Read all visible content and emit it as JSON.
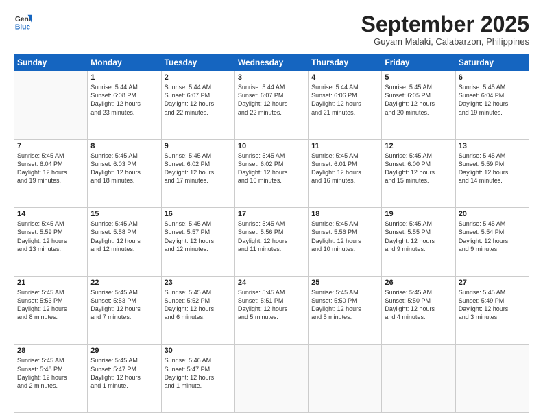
{
  "header": {
    "logo_line1": "General",
    "logo_line2": "Blue",
    "month": "September 2025",
    "location": "Guyam Malaki, Calabarzon, Philippines"
  },
  "weekdays": [
    "Sunday",
    "Monday",
    "Tuesday",
    "Wednesday",
    "Thursday",
    "Friday",
    "Saturday"
  ],
  "weeks": [
    [
      {
        "day": "",
        "text": ""
      },
      {
        "day": "1",
        "text": "Sunrise: 5:44 AM\nSunset: 6:08 PM\nDaylight: 12 hours\nand 23 minutes."
      },
      {
        "day": "2",
        "text": "Sunrise: 5:44 AM\nSunset: 6:07 PM\nDaylight: 12 hours\nand 22 minutes."
      },
      {
        "day": "3",
        "text": "Sunrise: 5:44 AM\nSunset: 6:07 PM\nDaylight: 12 hours\nand 22 minutes."
      },
      {
        "day": "4",
        "text": "Sunrise: 5:44 AM\nSunset: 6:06 PM\nDaylight: 12 hours\nand 21 minutes."
      },
      {
        "day": "5",
        "text": "Sunrise: 5:45 AM\nSunset: 6:05 PM\nDaylight: 12 hours\nand 20 minutes."
      },
      {
        "day": "6",
        "text": "Sunrise: 5:45 AM\nSunset: 6:04 PM\nDaylight: 12 hours\nand 19 minutes."
      }
    ],
    [
      {
        "day": "7",
        "text": "Sunrise: 5:45 AM\nSunset: 6:04 PM\nDaylight: 12 hours\nand 19 minutes."
      },
      {
        "day": "8",
        "text": "Sunrise: 5:45 AM\nSunset: 6:03 PM\nDaylight: 12 hours\nand 18 minutes."
      },
      {
        "day": "9",
        "text": "Sunrise: 5:45 AM\nSunset: 6:02 PM\nDaylight: 12 hours\nand 17 minutes."
      },
      {
        "day": "10",
        "text": "Sunrise: 5:45 AM\nSunset: 6:02 PM\nDaylight: 12 hours\nand 16 minutes."
      },
      {
        "day": "11",
        "text": "Sunrise: 5:45 AM\nSunset: 6:01 PM\nDaylight: 12 hours\nand 16 minutes."
      },
      {
        "day": "12",
        "text": "Sunrise: 5:45 AM\nSunset: 6:00 PM\nDaylight: 12 hours\nand 15 minutes."
      },
      {
        "day": "13",
        "text": "Sunrise: 5:45 AM\nSunset: 5:59 PM\nDaylight: 12 hours\nand 14 minutes."
      }
    ],
    [
      {
        "day": "14",
        "text": "Sunrise: 5:45 AM\nSunset: 5:59 PM\nDaylight: 12 hours\nand 13 minutes."
      },
      {
        "day": "15",
        "text": "Sunrise: 5:45 AM\nSunset: 5:58 PM\nDaylight: 12 hours\nand 12 minutes."
      },
      {
        "day": "16",
        "text": "Sunrise: 5:45 AM\nSunset: 5:57 PM\nDaylight: 12 hours\nand 12 minutes."
      },
      {
        "day": "17",
        "text": "Sunrise: 5:45 AM\nSunset: 5:56 PM\nDaylight: 12 hours\nand 11 minutes."
      },
      {
        "day": "18",
        "text": "Sunrise: 5:45 AM\nSunset: 5:56 PM\nDaylight: 12 hours\nand 10 minutes."
      },
      {
        "day": "19",
        "text": "Sunrise: 5:45 AM\nSunset: 5:55 PM\nDaylight: 12 hours\nand 9 minutes."
      },
      {
        "day": "20",
        "text": "Sunrise: 5:45 AM\nSunset: 5:54 PM\nDaylight: 12 hours\nand 9 minutes."
      }
    ],
    [
      {
        "day": "21",
        "text": "Sunrise: 5:45 AM\nSunset: 5:53 PM\nDaylight: 12 hours\nand 8 minutes."
      },
      {
        "day": "22",
        "text": "Sunrise: 5:45 AM\nSunset: 5:53 PM\nDaylight: 12 hours\nand 7 minutes."
      },
      {
        "day": "23",
        "text": "Sunrise: 5:45 AM\nSunset: 5:52 PM\nDaylight: 12 hours\nand 6 minutes."
      },
      {
        "day": "24",
        "text": "Sunrise: 5:45 AM\nSunset: 5:51 PM\nDaylight: 12 hours\nand 5 minutes."
      },
      {
        "day": "25",
        "text": "Sunrise: 5:45 AM\nSunset: 5:50 PM\nDaylight: 12 hours\nand 5 minutes."
      },
      {
        "day": "26",
        "text": "Sunrise: 5:45 AM\nSunset: 5:50 PM\nDaylight: 12 hours\nand 4 minutes."
      },
      {
        "day": "27",
        "text": "Sunrise: 5:45 AM\nSunset: 5:49 PM\nDaylight: 12 hours\nand 3 minutes."
      }
    ],
    [
      {
        "day": "28",
        "text": "Sunrise: 5:45 AM\nSunset: 5:48 PM\nDaylight: 12 hours\nand 2 minutes."
      },
      {
        "day": "29",
        "text": "Sunrise: 5:45 AM\nSunset: 5:47 PM\nDaylight: 12 hours\nand 1 minute."
      },
      {
        "day": "30",
        "text": "Sunrise: 5:46 AM\nSunset: 5:47 PM\nDaylight: 12 hours\nand 1 minute."
      },
      {
        "day": "",
        "text": ""
      },
      {
        "day": "",
        "text": ""
      },
      {
        "day": "",
        "text": ""
      },
      {
        "day": "",
        "text": ""
      }
    ]
  ]
}
